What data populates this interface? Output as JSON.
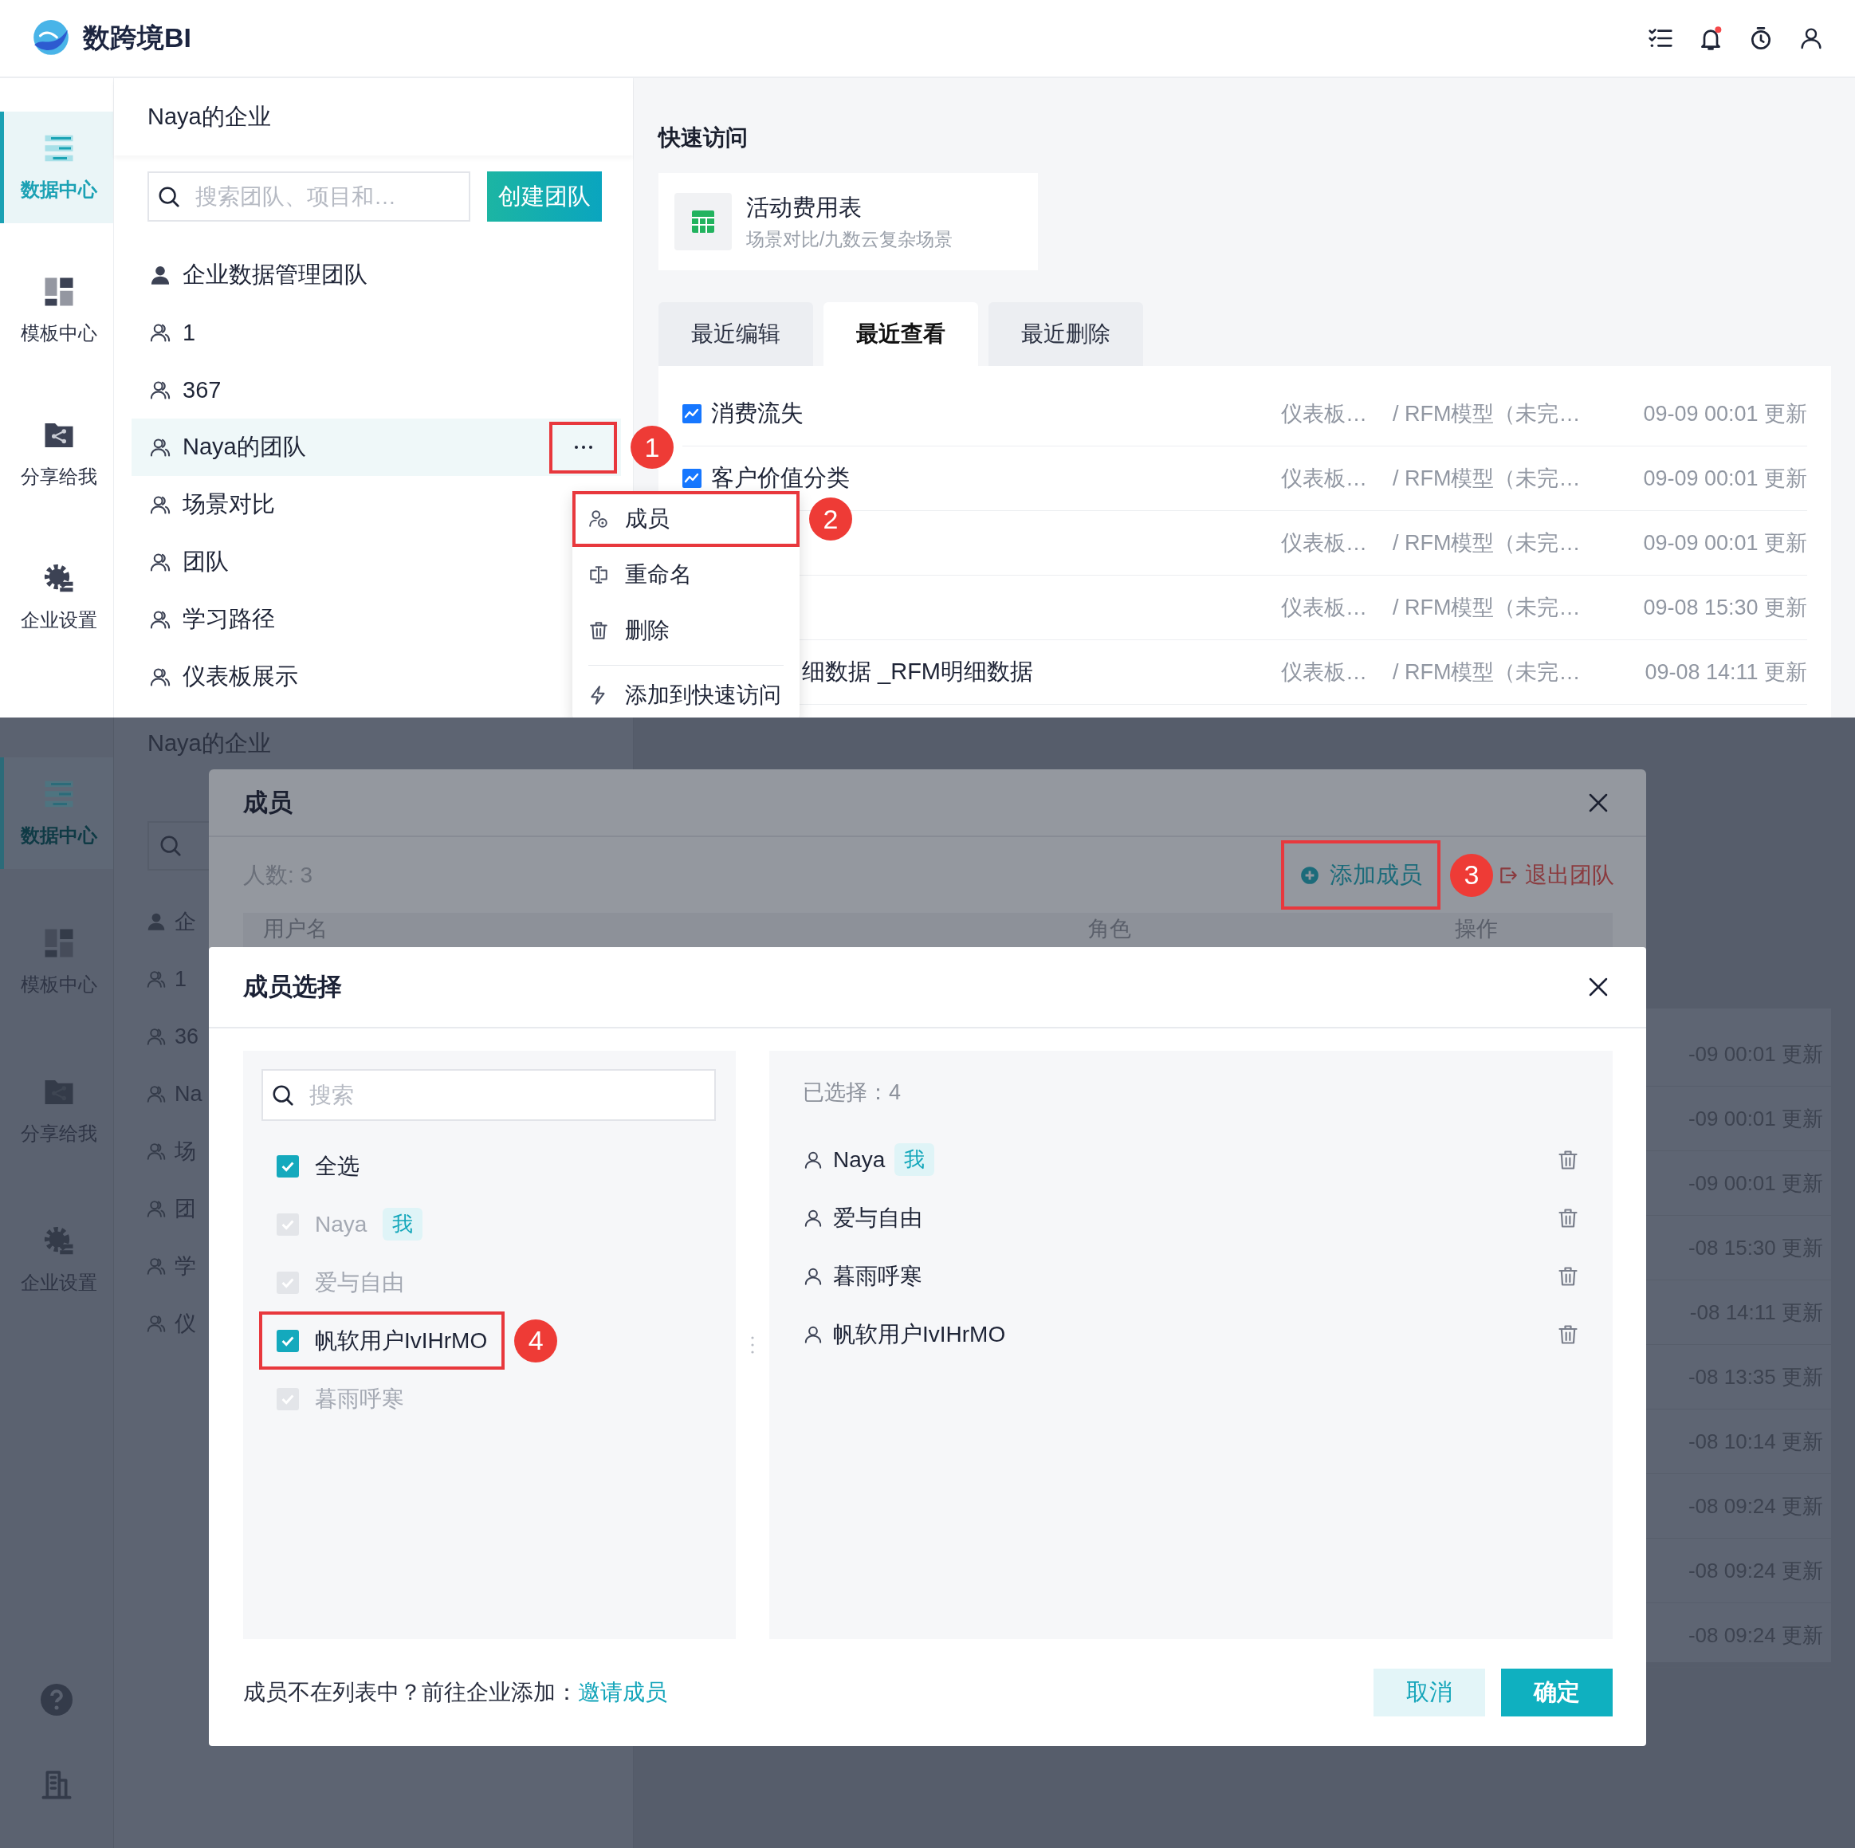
{
  "top": {
    "logo": "数跨境BI",
    "rail": [
      {
        "label": "数据中心",
        "kind": "data",
        "selected": true
      },
      {
        "label": "模板中心",
        "kind": "template",
        "selected": false
      },
      {
        "label": "分享给我",
        "kind": "share",
        "selected": false
      },
      {
        "label": "企业设置",
        "kind": "settings",
        "selected": false
      }
    ],
    "team_panel": {
      "title": "Naya的企业",
      "search_placeholder": "搜索团队、项目和…",
      "create_button": "创建团队",
      "teams": [
        {
          "name": "企业数据管理团队",
          "kind": "enterprise",
          "selected": false
        },
        {
          "name": "1",
          "kind": "team",
          "selected": false
        },
        {
          "name": "367",
          "kind": "team",
          "selected": false
        },
        {
          "name": "Naya的团队",
          "kind": "team",
          "selected": true,
          "more_callout": "1"
        },
        {
          "name": "场景对比",
          "kind": "team",
          "selected": false
        },
        {
          "name": "团队",
          "kind": "team",
          "selected": false
        },
        {
          "name": "学习路径",
          "kind": "team",
          "selected": false
        },
        {
          "name": "仪表板展示",
          "kind": "team",
          "selected": false
        }
      ]
    },
    "context_menu": {
      "items": [
        {
          "label": "成员",
          "kind": "members",
          "highlighted": true,
          "callout": "2"
        },
        {
          "label": "重命名",
          "kind": "rename",
          "highlighted": false
        },
        {
          "label": "删除",
          "kind": "delete",
          "highlighted": false
        },
        {
          "label": "添加到快速访问",
          "kind": "quick",
          "highlighted": false
        }
      ]
    },
    "quick_access": {
      "title": "快速访问",
      "cards": [
        {
          "title": "活动费用表",
          "subtitle": "场景对比/九数云复杂场景"
        }
      ]
    },
    "tabs": [
      {
        "label": "最近编辑",
        "selected": false
      },
      {
        "label": "最近查看",
        "selected": true
      },
      {
        "label": "最近删除",
        "selected": false
      }
    ],
    "recent": [
      {
        "kind": "full",
        "name": "消费流失",
        "location": "仪表板…",
        "path": "/ RFM模型（未完…",
        "time": "09-09 00:01 更新"
      },
      {
        "kind": "full",
        "name": "客户价值分类",
        "location": "仪表板…",
        "path": "/ RFM模型（未完…",
        "time": "09-09 00:01 更新"
      },
      {
        "kind": "covered",
        "location": "仪表板…",
        "path": "/ RFM模型（未完…",
        "time": "09-09 00:01 更新"
      },
      {
        "kind": "covered",
        "location": "仪表板…",
        "path": "/ RFM模型（未完…",
        "time": "09-08 15:30 更新"
      },
      {
        "kind": "covered",
        "name": "细数据 _RFM明细数据",
        "location": "仪表板…",
        "path": "/ RFM模型（未完…",
        "time": "09-08 14:11 更新"
      }
    ]
  },
  "bottom": {
    "rail": [
      {
        "label": "数据中心",
        "kind": "data",
        "selected": true
      },
      {
        "label": "模板中心",
        "kind": "template",
        "selected": false
      },
      {
        "label": "分享给我",
        "kind": "share",
        "selected": false
      },
      {
        "label": "企业设置",
        "kind": "settings",
        "selected": false
      }
    ],
    "team_panel": {
      "title": "Naya的企业",
      "teams": [
        {
          "name": "企",
          "kind": "enterprise"
        },
        {
          "name": "1",
          "kind": "team"
        },
        {
          "name": "36",
          "kind": "team"
        },
        {
          "name": "Na",
          "kind": "team"
        },
        {
          "name": "场",
          "kind": "team"
        },
        {
          "name": "团",
          "kind": "team"
        },
        {
          "name": "学",
          "kind": "team"
        },
        {
          "name": "仪",
          "kind": "team"
        }
      ]
    },
    "recent_times": [
      "-09 00:01 更新",
      "-09 00:01 更新",
      "-09 00:01 更新",
      "-08 15:30 更新",
      "-08 14:11 更新",
      "-08 13:35 更新",
      "-08 10:14 更新",
      "-08 09:24 更新",
      "-08 09:24 更新",
      "-08 09:24 更新"
    ],
    "members_dialog": {
      "title": "成员",
      "count": "人数: 3",
      "add_button": "添加成员",
      "add_callout": "3",
      "leave_button": "退出团队",
      "columns": [
        "用户名",
        "角色",
        "操作"
      ]
    },
    "select_dialog": {
      "title": "成员选择",
      "search_placeholder": "搜索",
      "options": [
        {
          "label": "全选",
          "checked": true,
          "disabled": false
        },
        {
          "label": "Naya",
          "tag": "我",
          "checked": true,
          "disabled": true
        },
        {
          "label": "爱与自由",
          "checked": true,
          "disabled": true
        },
        {
          "label": "帆软用户IvIHrMO",
          "checked": true,
          "disabled": false,
          "callout": "4"
        },
        {
          "label": "暮雨呼寒",
          "checked": true,
          "disabled": true
        }
      ],
      "chosen_label": "已选择：4",
      "chosen": [
        {
          "name": "Naya",
          "tag": "我"
        },
        {
          "name": "爱与自由"
        },
        {
          "name": "暮雨呼寒"
        },
        {
          "name": "帆软用户IvIHrMO"
        }
      ],
      "footer_text": "成员不在列表中？前往企业添加：",
      "invite_link": "邀请成员",
      "cancel_button": "取消",
      "confirm_button": "确定"
    }
  }
}
